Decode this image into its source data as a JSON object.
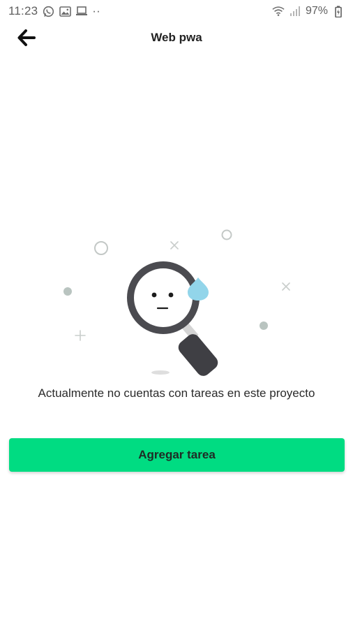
{
  "status_bar": {
    "time": "11:23",
    "more_indicator": "··",
    "battery_percent": "97%",
    "icons": [
      "whatsapp-icon",
      "gallery-icon",
      "laptop-icon",
      "wifi-icon",
      "signal-icon",
      "battery-icon"
    ]
  },
  "app_bar": {
    "back_icon": "arrow-left-icon",
    "title": "Web pwa"
  },
  "empty_state": {
    "illustration": "magnifying-glass-sad-face",
    "message": "Actualmente no cuentas con tareas en este proyecto"
  },
  "actions": {
    "add_task_label": "Agregar tarea"
  },
  "colors": {
    "accent": "#00dc82",
    "magnifier_body": "#4a4a4f",
    "drop": "#8fd4ea",
    "decor": "#bfc7c4"
  }
}
